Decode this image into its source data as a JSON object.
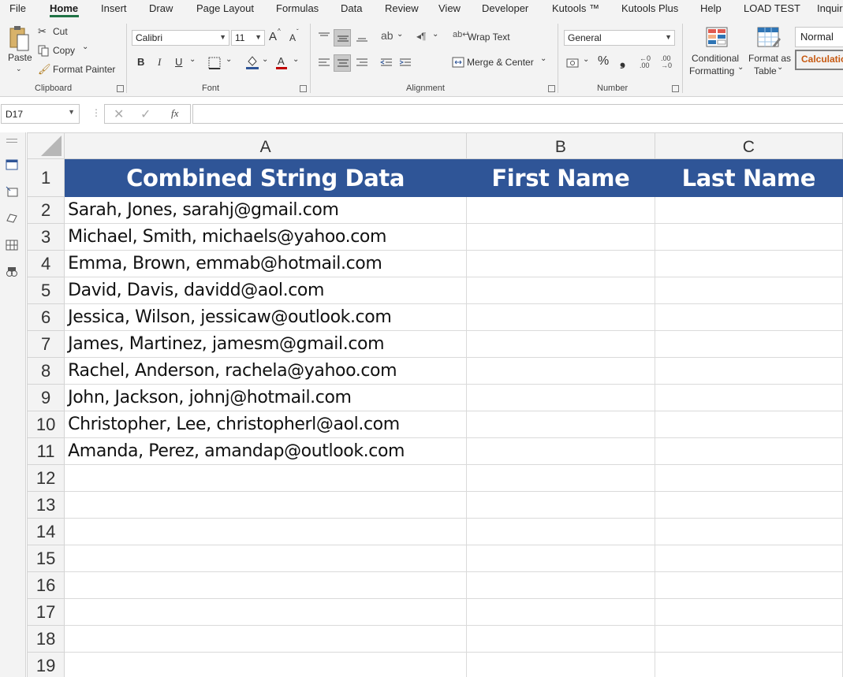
{
  "menu": [
    "File",
    "Home",
    "Insert",
    "Draw",
    "Page Layout",
    "Formulas",
    "Data",
    "Review",
    "View",
    "Developer",
    "Kutools ™",
    "Kutools Plus",
    "Help",
    "LOAD TEST",
    "Inquire"
  ],
  "ribbon": {
    "clipboard": {
      "paste": "Paste",
      "cut": "Cut",
      "copy": "Copy",
      "format_painter": "Format Painter",
      "label": "Clipboard"
    },
    "font": {
      "name": "Calibri",
      "size": "11",
      "grow": "A",
      "shrink": "A",
      "bold": "B",
      "italic": "I",
      "underline": "U",
      "label": "Font"
    },
    "alignment": {
      "wrap_text": "Wrap Text",
      "merge_center": "Merge & Center",
      "label": "Alignment"
    },
    "number": {
      "format": "General",
      "label": "Number"
    },
    "styles": {
      "conditional_formatting": [
        "Conditional",
        "Formatting"
      ],
      "format_as_table": [
        "Format as",
        "Table"
      ],
      "normal": "Normal",
      "calculation": "Calculation"
    }
  },
  "formula_bar": {
    "name_box": "D17",
    "fx": "fx",
    "value": ""
  },
  "columns": [
    "A",
    "B",
    "C"
  ],
  "header_row": [
    "Combined String Data",
    "First Name",
    "Last Name"
  ],
  "rows": [
    {
      "n": "2",
      "a": "Sarah, Jones, sarahj@gmail.com"
    },
    {
      "n": "3",
      "a": "Michael,  Smith,  michaels@yahoo.com"
    },
    {
      "n": "4",
      "a": "Emma,  Brown,  emmab@hotmail.com"
    },
    {
      "n": "5",
      "a": "David,  Davis,  davidd@aol.com"
    },
    {
      "n": "6",
      "a": "Jessica,  Wilson,  jessicaw@outlook.com"
    },
    {
      "n": "7",
      "a": "James,  Martinez,  jamesm@gmail.com"
    },
    {
      "n": "8",
      "a": "Rachel,  Anderson,  rachela@yahoo.com"
    },
    {
      "n": "9",
      "a": "John,  Jackson,  johnj@hotmail.com"
    },
    {
      "n": "10",
      "a": "Christopher,  Lee,  christopherl@aol.com"
    },
    {
      "n": "11",
      "a": "Amanda,  Perez,  amandap@outlook.com"
    },
    {
      "n": "12",
      "a": ""
    },
    {
      "n": "13",
      "a": ""
    },
    {
      "n": "14",
      "a": ""
    },
    {
      "n": "15",
      "a": ""
    },
    {
      "n": "16",
      "a": ""
    },
    {
      "n": "17",
      "a": ""
    },
    {
      "n": "18",
      "a": ""
    },
    {
      "n": "19",
      "a": ""
    }
  ],
  "colors": {
    "header_fill": "#2f5597",
    "header_text": "#ffffff",
    "accent": "#217346",
    "calculation_text": "#c65911"
  }
}
